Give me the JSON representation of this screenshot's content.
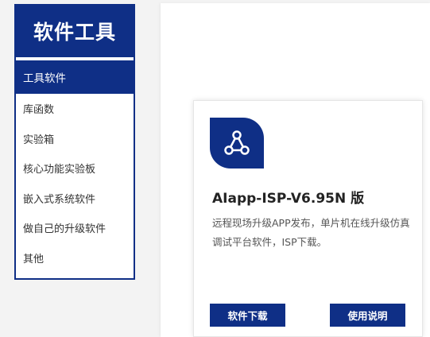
{
  "sidebar": {
    "title": "软件工具",
    "items": [
      {
        "label": "工具软件",
        "active": true
      },
      {
        "label": "库函数",
        "active": false
      },
      {
        "label": "实验箱",
        "active": false
      },
      {
        "label": "核心功能实验板",
        "active": false
      },
      {
        "label": "嵌入式系统软件",
        "active": false
      },
      {
        "label": "做自己的升级软件",
        "active": false
      },
      {
        "label": "其他",
        "active": false
      }
    ]
  },
  "card": {
    "icon": "share-network-icon",
    "title": "AIapp-ISP-V6.95N 版",
    "description": "远程现场升级APP发布，单片机在线升级仿真调试平台软件，ISP下载。",
    "buttons": {
      "download": "软件下载",
      "manual": "使用说明"
    }
  },
  "colors": {
    "brand": "#0f2f86",
    "background": "#f3f3f3",
    "text": "#333333"
  }
}
